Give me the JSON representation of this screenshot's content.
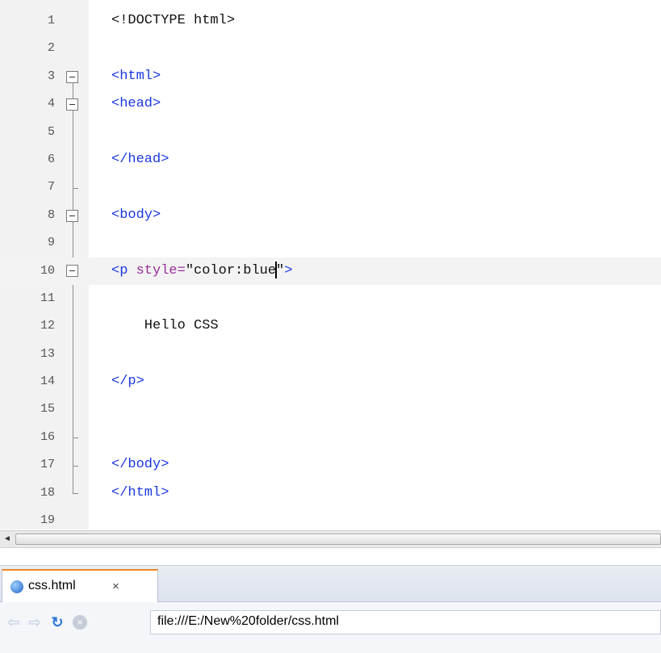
{
  "editor": {
    "lines": [
      {
        "n": "1",
        "tokens": [
          {
            "t": "<!DOCTYPE html>",
            "c": "plain"
          }
        ]
      },
      {
        "n": "2",
        "tokens": []
      },
      {
        "n": "3",
        "tokens": [
          {
            "t": "<html>",
            "c": "tag"
          }
        ]
      },
      {
        "n": "4",
        "tokens": [
          {
            "t": "<head>",
            "c": "tag"
          }
        ]
      },
      {
        "n": "5",
        "tokens": []
      },
      {
        "n": "6",
        "tokens": [
          {
            "t": "</head>",
            "c": "tag"
          }
        ]
      },
      {
        "n": "7",
        "tokens": []
      },
      {
        "n": "8",
        "tokens": [
          {
            "t": "<body>",
            "c": "tag"
          }
        ]
      },
      {
        "n": "9",
        "tokens": []
      },
      {
        "n": "10",
        "current": true,
        "tokens": [
          {
            "t": "<p ",
            "c": "tag"
          },
          {
            "t": "style=",
            "c": "attr"
          },
          {
            "t": "\"color:blue",
            "c": "str"
          },
          {
            "t": "",
            "c": "caret"
          },
          {
            "t": "\"",
            "c": "str"
          },
          {
            "t": ">",
            "c": "tag"
          }
        ]
      },
      {
        "n": "11",
        "tokens": []
      },
      {
        "n": "12",
        "tokens": [
          {
            "t": "    Hello CSS",
            "c": "plain"
          }
        ]
      },
      {
        "n": "13",
        "tokens": []
      },
      {
        "n": "14",
        "tokens": [
          {
            "t": "</p>",
            "c": "tag"
          }
        ]
      },
      {
        "n": "15",
        "tokens": []
      },
      {
        "n": "16",
        "tokens": []
      },
      {
        "n": "17",
        "tokens": [
          {
            "t": "</body>",
            "c": "tag"
          }
        ]
      },
      {
        "n": "18",
        "tokens": [
          {
            "t": "</html>",
            "c": "tag"
          }
        ]
      },
      {
        "n": "19",
        "tokens": []
      }
    ],
    "fold_boxes_on_lines": [
      3,
      4,
      8,
      10
    ],
    "fold_ticks_on_lines": [
      7,
      16,
      17
    ],
    "fold_end_on_line": 18,
    "colors": {
      "tag": "#1a38e0",
      "attr": "#9a2f9a",
      "plain": "#111111",
      "line_number": "#555555",
      "current_line": "#f3f3f3"
    }
  },
  "scrollbar": {
    "left_arrow": "◄"
  },
  "browser": {
    "tab": {
      "label": "css.html",
      "close": "×",
      "icon": "page-globe-icon"
    },
    "nav": {
      "back": "⇦",
      "forward": "⇨",
      "refresh": "↻",
      "stop": "×"
    },
    "address": "file:///E:/New%20folder/css.html"
  }
}
